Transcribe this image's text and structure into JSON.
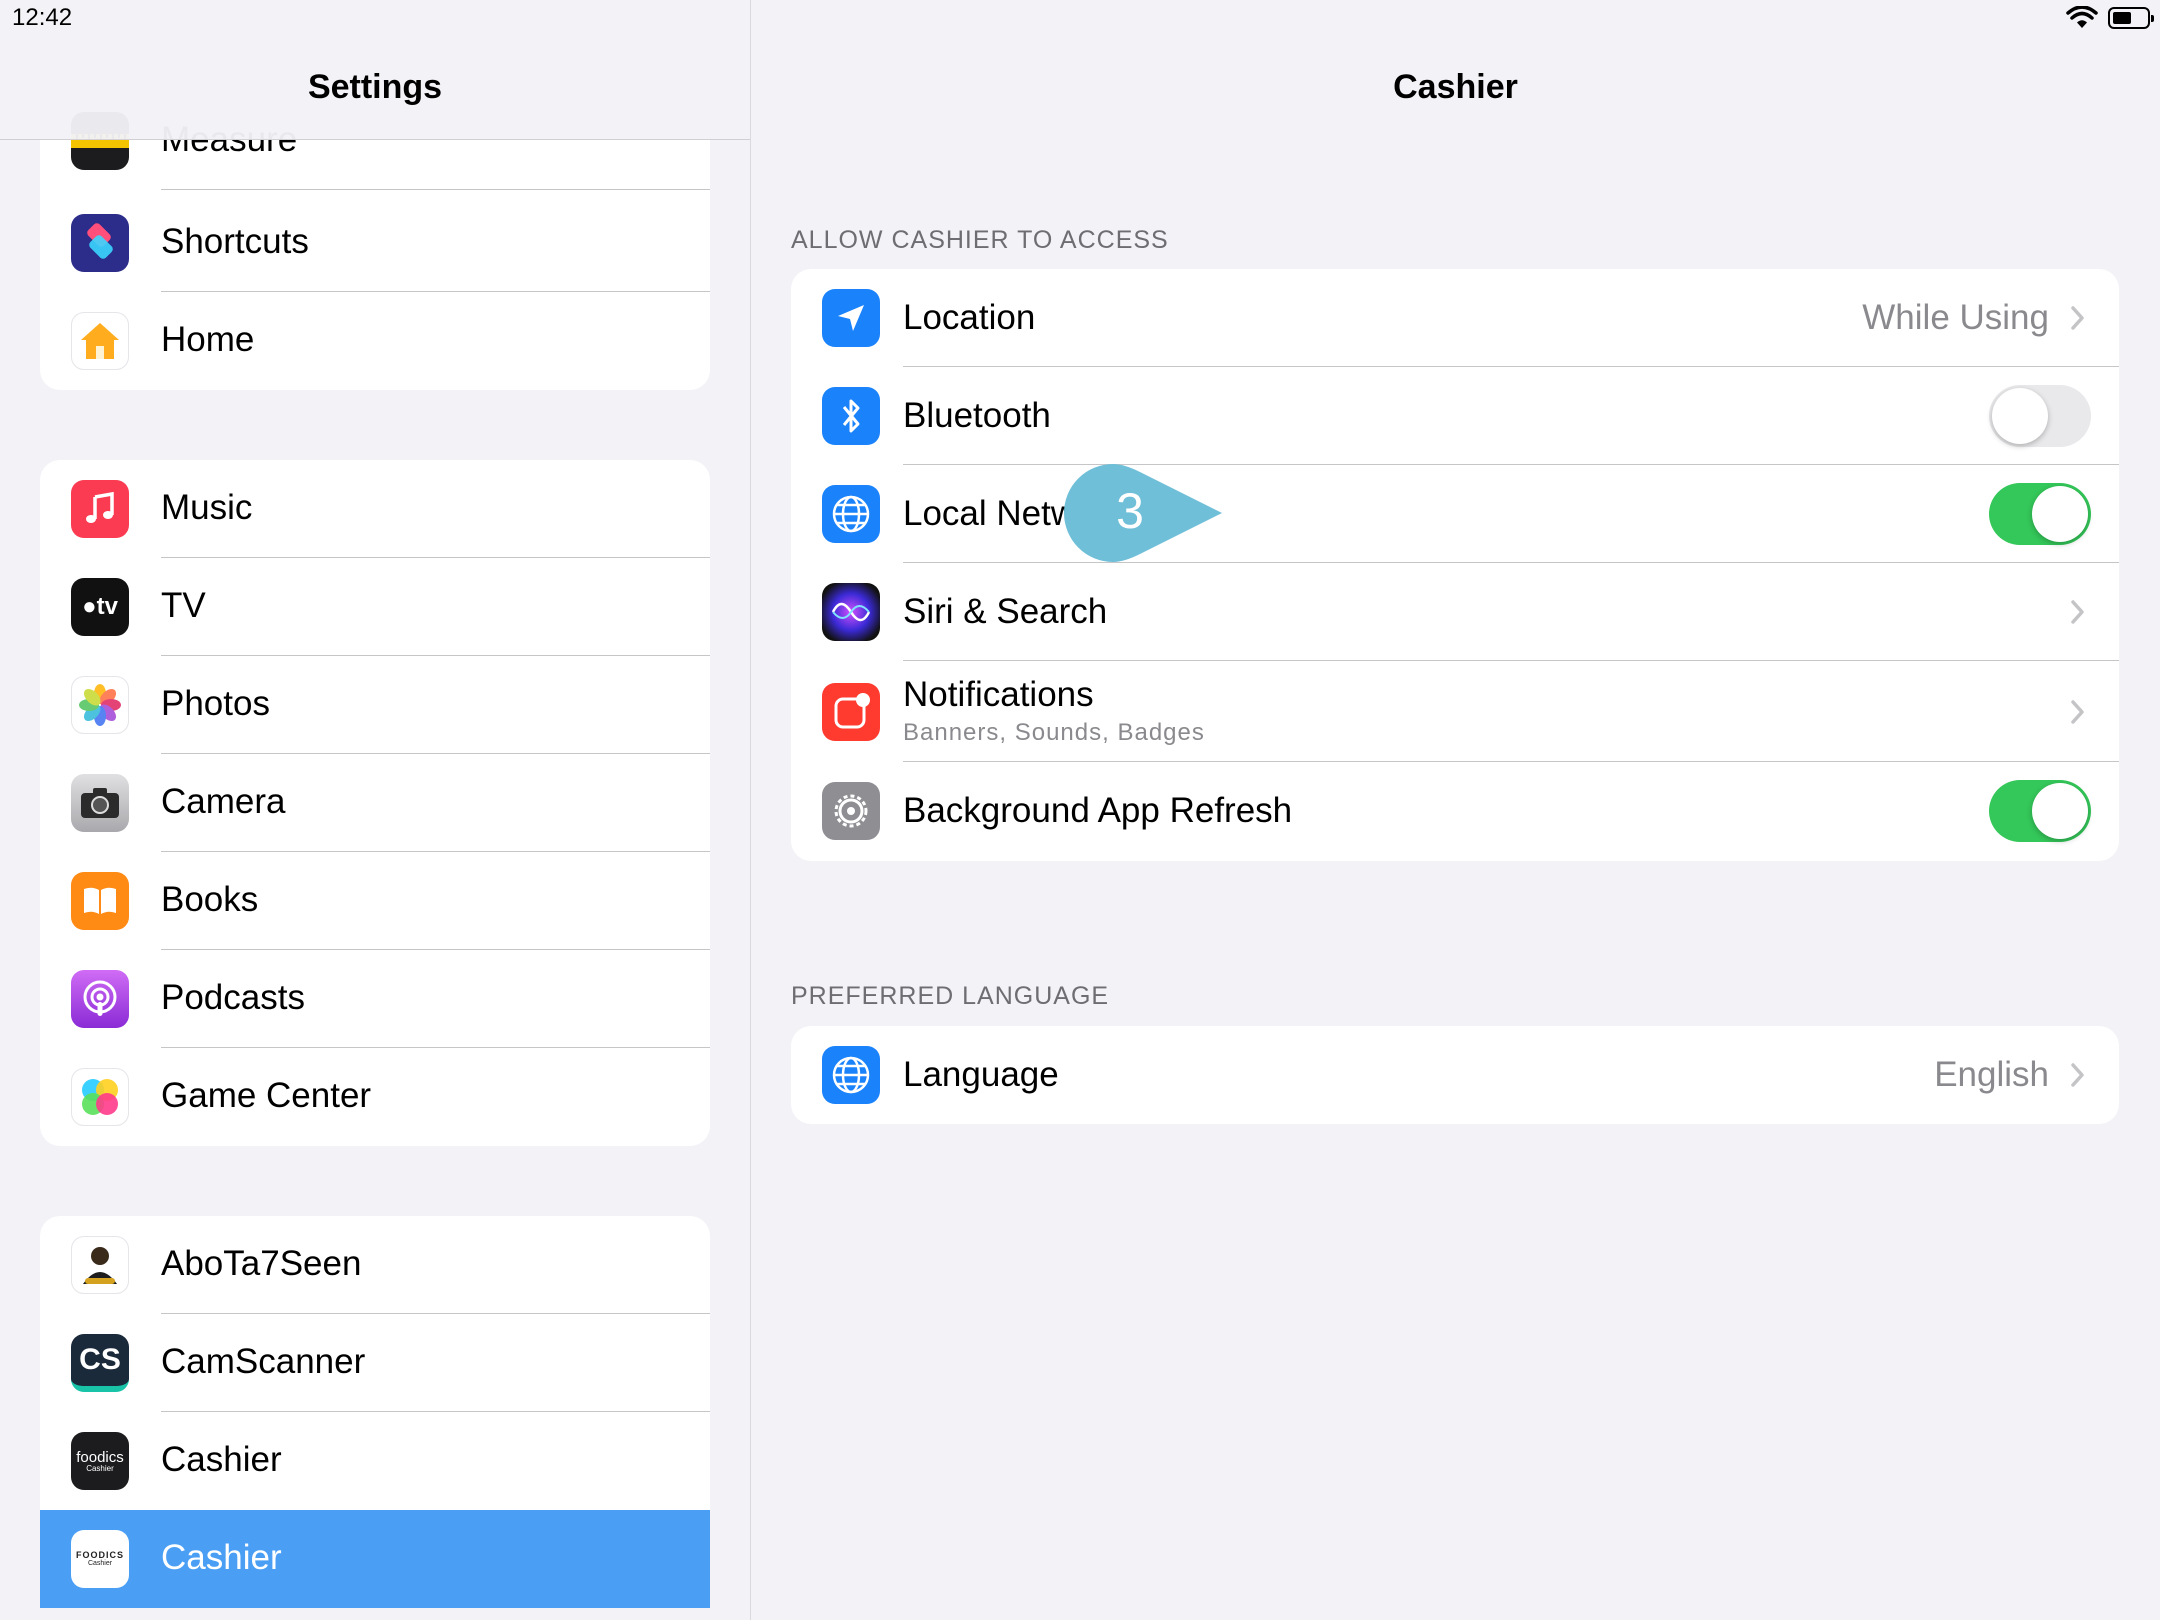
{
  "status_bar": {
    "time": "12:42"
  },
  "sidebar": {
    "title": "Settings",
    "group1": [
      "Measure",
      "Shortcuts",
      "Home"
    ],
    "group2": [
      "Music",
      "TV",
      "Photos",
      "Camera",
      "Books",
      "Podcasts",
      "Game Center"
    ],
    "group3": [
      "AboTa7Seen",
      "CamScanner",
      "Cashier",
      "Cashier"
    ],
    "selected_item": "Cashier"
  },
  "detail": {
    "title": "Cashier",
    "access_header": "ALLOW CASHIER TO ACCESS",
    "rows": {
      "location": {
        "label": "Location",
        "value": "While Using"
      },
      "bluetooth": {
        "label": "Bluetooth",
        "enabled": false
      },
      "local_network": {
        "label": "Local Network",
        "enabled": true
      },
      "siri": {
        "label": "Siri & Search"
      },
      "notifications": {
        "label": "Notifications",
        "subtitle": "Banners, Sounds, Badges"
      },
      "background_refresh": {
        "label": "Background App Refresh",
        "enabled": true
      }
    },
    "language_header": "PREFERRED LANGUAGE",
    "language": {
      "label": "Language",
      "value": "English"
    }
  },
  "annotation": {
    "step_number": "3",
    "color": "#6fbfd8"
  },
  "colors": {
    "accent": "#4a9ff5",
    "toggle_on": "#34c759",
    "background": "#f2f2f7"
  },
  "icons": {
    "group1": [
      "measure-icon",
      "shortcuts-icon",
      "home-icon"
    ],
    "group2": [
      "music-icon",
      "tv-icon",
      "photos-icon",
      "camera-icon",
      "books-icon",
      "podcasts-icon",
      "game-center-icon"
    ],
    "group3": [
      "abota7seen-icon",
      "camscanner-icon",
      "foodics-cashier-icon",
      "foodics-cashier-icon"
    ],
    "detail": [
      "location-arrow-icon",
      "bluetooth-icon",
      "globe-icon",
      "siri-icon",
      "notifications-icon",
      "gear-icon",
      "globe-icon"
    ]
  }
}
